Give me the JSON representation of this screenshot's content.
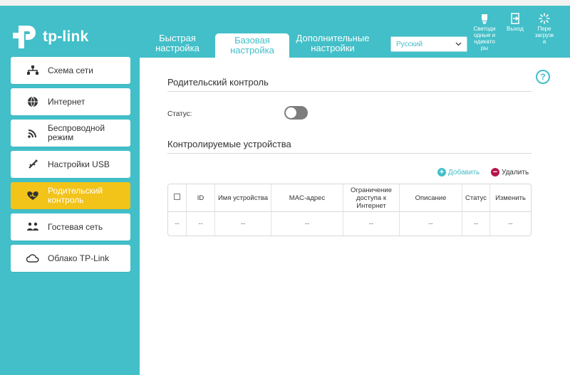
{
  "brand": {
    "logo_text": "tp-link"
  },
  "tabs": [
    {
      "label_line1": "Быстрая",
      "label_line2": "настройка"
    },
    {
      "label_line1": "Базовая",
      "label_line2": "настройка"
    },
    {
      "label_line1": "Дополнительные",
      "label_line2": "настройки"
    }
  ],
  "language": {
    "selected": "Русский"
  },
  "header_buttons": {
    "led": [
      "Светоди",
      "одные и",
      "ндикато",
      "ры"
    ],
    "logout": [
      "Выход"
    ],
    "reboot": [
      "Пере",
      "загрузк",
      "а"
    ]
  },
  "sidebar": {
    "items": [
      {
        "label": "Схема сети",
        "icon": "network-map-icon"
      },
      {
        "label": "Интернет",
        "icon": "globe-icon"
      },
      {
        "label_line1": "Беспроводной",
        "label_line2": "режим",
        "icon": "wireless-icon"
      },
      {
        "label": "Настройки USB",
        "icon": "usb-icon"
      },
      {
        "label_line1": "Родительский",
        "label_line2": "контроль",
        "icon": "parental-control-icon",
        "active": true
      },
      {
        "label": "Гостевая сеть",
        "icon": "guest-network-icon"
      },
      {
        "label": "Облако TP-Link",
        "icon": "cloud-icon"
      }
    ]
  },
  "main": {
    "section1_title": "Родительский контроль",
    "status_label": "Статус:",
    "status_on": false,
    "section2_title": "Контролируемые устройства",
    "add_label": "Добавить",
    "delete_label": "Удалить",
    "table": {
      "headers": [
        "ID",
        "Имя устройства",
        "MAC-адрес",
        "Ограничение доступа к Интернет",
        "Описание",
        "Статус",
        "Изменить"
      ],
      "rows": [
        [
          "--",
          "--",
          "--",
          "--",
          "--",
          "--",
          "--",
          "--"
        ]
      ]
    }
  },
  "colors": {
    "accent": "#42bfc8",
    "active_nav": "#f2c319",
    "delete": "#b5174b"
  }
}
